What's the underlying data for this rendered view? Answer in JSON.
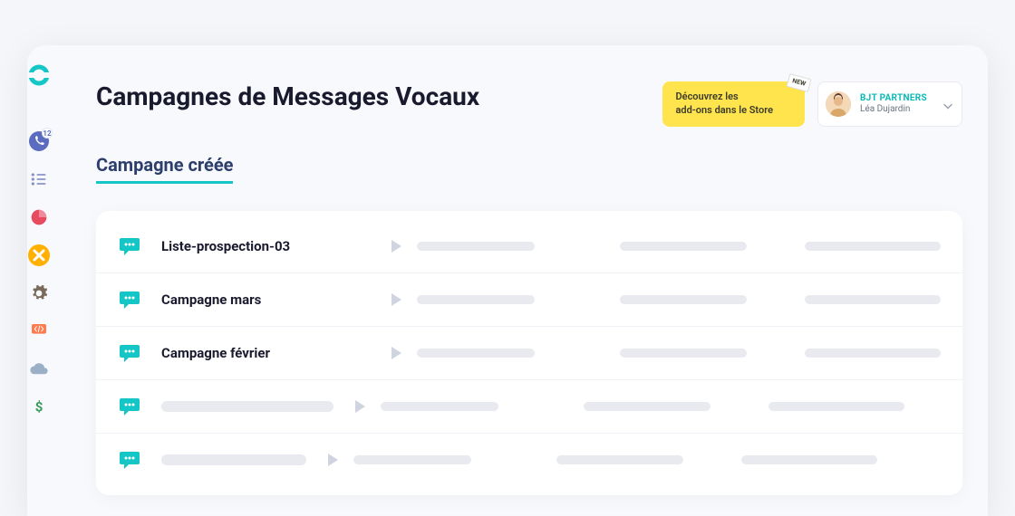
{
  "header": {
    "title": "Campagnes de Messages Vocaux",
    "promo_line1": "Découvrez les",
    "promo_line2": "add-ons dans le Store",
    "promo_ribbon": "NEW",
    "account_company": "BJT PARTNERS",
    "account_user": "Léa Dujardin"
  },
  "tab": {
    "label": "Campagne créée"
  },
  "sidebar": {
    "phone_badge": "12"
  },
  "campaigns": [
    {
      "name": "Liste-prospection-03"
    },
    {
      "name": "Campagne mars"
    },
    {
      "name": "Campagne février"
    },
    {
      "name": ""
    },
    {
      "name": ""
    }
  ]
}
